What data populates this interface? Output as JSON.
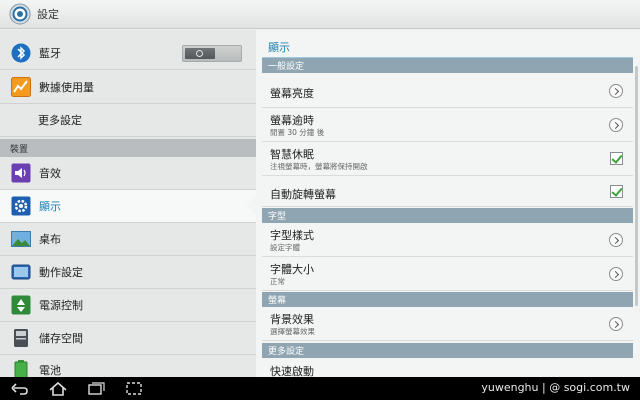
{
  "titlebar": {
    "title": "設定",
    "icon": "settings-gear-icon"
  },
  "left": {
    "bluetooth": {
      "label": "藍牙",
      "icon": "bluetooth-icon",
      "toggle": "off"
    },
    "data_usage": {
      "label": "數據使用量",
      "icon": "data-usage-icon"
    },
    "more": {
      "label": "更多設定"
    },
    "device_header": "裝置",
    "sound": {
      "label": "音效",
      "icon": "speaker-icon"
    },
    "display": {
      "label": "顯示",
      "icon": "display-gear-icon",
      "selected": true
    },
    "wallpaper": {
      "label": "桌布",
      "icon": "wallpaper-icon"
    },
    "motion": {
      "label": "動作設定",
      "icon": "motion-icon"
    },
    "power": {
      "label": "電源控制",
      "icon": "recycle-icon"
    },
    "storage": {
      "label": "儲存空間",
      "icon": "storage-icon"
    },
    "battery": {
      "label": "電池",
      "icon": "battery-icon"
    }
  },
  "right": {
    "title": "顯示",
    "sections": {
      "general": "一般設定",
      "font": "字型",
      "screen": "螢幕",
      "more": "更多設定"
    },
    "brightness": {
      "title": "螢幕亮度"
    },
    "timeout": {
      "title": "螢幕逾時",
      "sub": "閒置 30 分鐘 後"
    },
    "smart_stay": {
      "title": "智慧休眠",
      "sub": "注視螢幕時，螢幕將保持開啟",
      "checked": true
    },
    "auto_rotate": {
      "title": "自動旋轉螢幕",
      "checked": true
    },
    "font_style": {
      "title": "字型樣式",
      "sub": "設定字體"
    },
    "font_size": {
      "title": "字體大小",
      "sub": "正常"
    },
    "bg_effect": {
      "title": "背景效果",
      "sub": "選擇螢幕效果"
    },
    "quick_launch": {
      "title": "快速啟動"
    }
  },
  "navbar": {
    "watermark": "yuwenghu  |  @ sogi.com.tw"
  },
  "colors": {
    "accent": "#1f7fb0",
    "section_header": "#8fa5b2",
    "check": "#3aa33a"
  }
}
